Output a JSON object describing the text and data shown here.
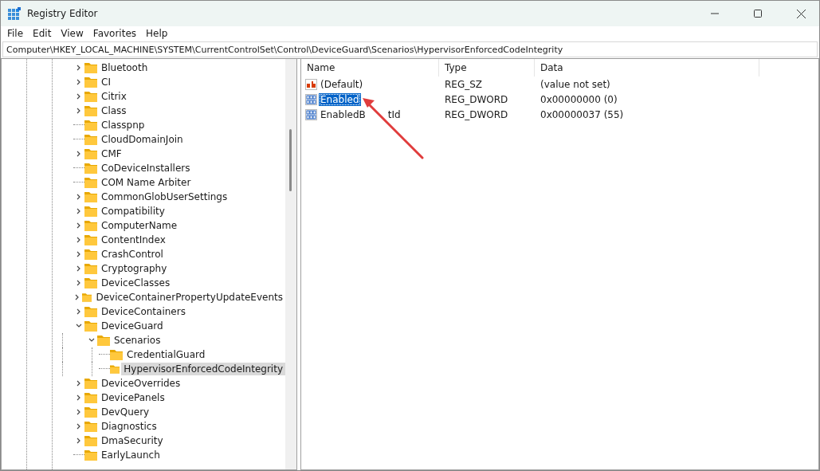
{
  "window": {
    "title": "Registry Editor"
  },
  "menu": [
    "File",
    "Edit",
    "View",
    "Favorites",
    "Help"
  ],
  "address": "Computer\\HKEY_LOCAL_MACHINE\\SYSTEM\\CurrentControlSet\\Control\\DeviceGuard\\Scenarios\\HypervisorEnforcedCodeIntegrity",
  "tree": [
    {
      "label": "Bluetooth",
      "has_children": true,
      "expanded": false,
      "selected": false
    },
    {
      "label": "CI",
      "has_children": true,
      "expanded": false,
      "selected": false
    },
    {
      "label": "Citrix",
      "has_children": true,
      "expanded": false,
      "selected": false
    },
    {
      "label": "Class",
      "has_children": true,
      "expanded": false,
      "selected": false
    },
    {
      "label": "Classpnp",
      "has_children": false,
      "selected": false
    },
    {
      "label": "CloudDomainJoin",
      "has_children": false,
      "selected": false
    },
    {
      "label": "CMF",
      "has_children": true,
      "expanded": false,
      "selected": false
    },
    {
      "label": "CoDeviceInstallers",
      "has_children": false,
      "selected": false
    },
    {
      "label": "COM Name Arbiter",
      "has_children": false,
      "selected": false
    },
    {
      "label": "CommonGlobUserSettings",
      "has_children": true,
      "expanded": false,
      "selected": false
    },
    {
      "label": "Compatibility",
      "has_children": true,
      "expanded": false,
      "selected": false
    },
    {
      "label": "ComputerName",
      "has_children": true,
      "expanded": false,
      "selected": false
    },
    {
      "label": "ContentIndex",
      "has_children": true,
      "expanded": false,
      "selected": false
    },
    {
      "label": "CrashControl",
      "has_children": true,
      "expanded": false,
      "selected": false
    },
    {
      "label": "Cryptography",
      "has_children": true,
      "expanded": false,
      "selected": false
    },
    {
      "label": "DeviceClasses",
      "has_children": true,
      "expanded": false,
      "selected": false
    },
    {
      "label": "DeviceContainerPropertyUpdateEvents",
      "has_children": true,
      "expanded": false,
      "selected": false
    },
    {
      "label": "DeviceContainers",
      "has_children": true,
      "expanded": false,
      "selected": false
    },
    {
      "label": "DeviceGuard",
      "has_children": true,
      "expanded": true,
      "selected": false,
      "children": [
        {
          "label": "Scenarios",
          "has_children": true,
          "expanded": true,
          "selected": false,
          "children": [
            {
              "label": "CredentialGuard",
              "has_children": false,
              "selected": false
            },
            {
              "label": "HypervisorEnforcedCodeIntegrity",
              "has_children": false,
              "selected": true
            }
          ]
        }
      ]
    },
    {
      "label": "DeviceOverrides",
      "has_children": true,
      "expanded": false,
      "selected": false
    },
    {
      "label": "DevicePanels",
      "has_children": true,
      "expanded": false,
      "selected": false
    },
    {
      "label": "DevQuery",
      "has_children": true,
      "expanded": false,
      "selected": false
    },
    {
      "label": "Diagnostics",
      "has_children": true,
      "expanded": false,
      "selected": false
    },
    {
      "label": "DmaSecurity",
      "has_children": true,
      "expanded": false,
      "selected": false
    },
    {
      "label": "EarlyLaunch",
      "has_children": false,
      "selected": false
    }
  ],
  "values": {
    "columns": [
      "Name",
      "Type",
      "Data"
    ],
    "rows": [
      {
        "name": "(Default)",
        "kind": "string",
        "type": "REG_SZ",
        "data": "(value not set)",
        "selected": false
      },
      {
        "name": "Enabled",
        "kind": "binary",
        "type": "REG_DWORD",
        "data": "0x00000000 (0)",
        "selected": true
      },
      {
        "name": "EnabledB",
        "name_tail": "tId",
        "kind": "binary",
        "type": "REG_DWORD",
        "data": "0x00000037 (55)",
        "selected": false
      }
    ]
  }
}
